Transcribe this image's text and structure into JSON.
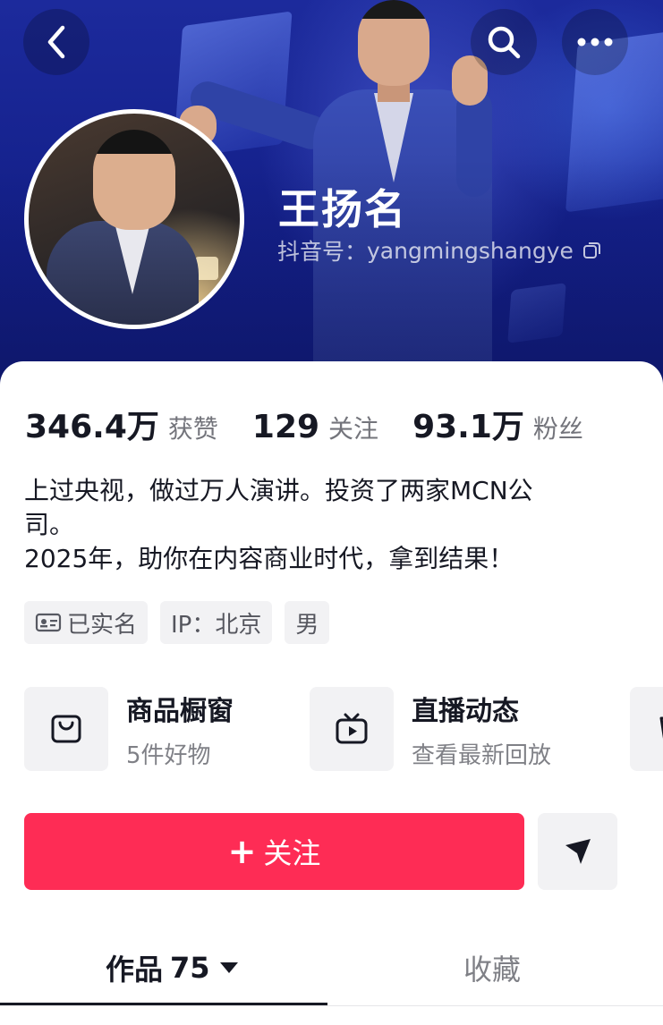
{
  "header": {
    "name": "王扬名",
    "handle_label": "抖音号：",
    "handle": "yangmingshangye"
  },
  "stats": [
    {
      "value": "346.4万",
      "label": "获赞"
    },
    {
      "value": "129",
      "label": "关注"
    },
    {
      "value": "93.1万",
      "label": "粉丝"
    }
  ],
  "bio": {
    "line1": "上过央视，做过万人演讲。投资了两家MCN公",
    "line2": "司。",
    "line3": "2025年，助你在内容商业时代，拿到结果！"
  },
  "tags": {
    "verified": "已实名",
    "ip": "IP：北京",
    "gender": "男"
  },
  "entries": [
    {
      "title": "商品橱窗",
      "subtitle": "5件好物",
      "icon": "shopping-bag-icon"
    },
    {
      "title": "直播动态",
      "subtitle": "查看最新回放",
      "icon": "tv-play-icon"
    }
  ],
  "actions": {
    "follow_plus": "+",
    "follow_label": "关注"
  },
  "tabs": {
    "works_label": "作品",
    "works_count": "75",
    "favorites_label": "收藏"
  },
  "colors": {
    "accent": "#fe2c55",
    "banner": "#14208a",
    "text": "#161823"
  }
}
